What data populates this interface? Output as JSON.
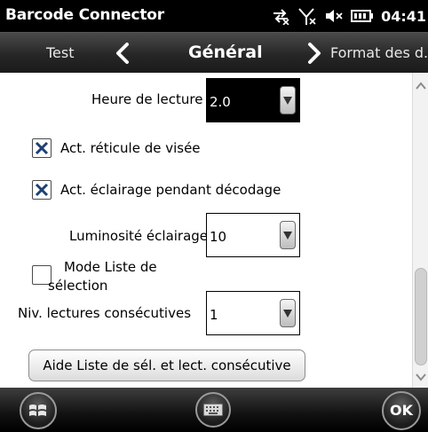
{
  "statusbar": {
    "app_title": "Barcode Connector",
    "time": "04:41",
    "icons": [
      "sync-icon",
      "signal-off-icon",
      "volume-off-icon",
      "battery-icon"
    ]
  },
  "tabs": {
    "prev_label": "Test",
    "current_label": "Général",
    "next_label": "Format des d..."
  },
  "form": {
    "read_time": {
      "label": "Heure de lecture",
      "value": "2.0"
    },
    "aim_reticle": {
      "label": "Act. réticule de visée",
      "checked": true
    },
    "illumination_decode": {
      "label": "Act. éclairage pendant décodage",
      "checked": true
    },
    "illumination_brightness": {
      "label": "Luminosité éclairage",
      "value": "10"
    },
    "picklist_mode": {
      "label_line1": "Mode Liste de",
      "label_line2": "sélection",
      "checked": false
    },
    "consecutive_reads": {
      "label": "Niv. lectures consécutives",
      "value": "1"
    },
    "help_button_label": "Aide Liste de sél. et lect. consécutive"
  },
  "bottombar": {
    "ok_label": "OK",
    "icons": [
      "windows-start-icon",
      "keyboard-icon"
    ]
  }
}
